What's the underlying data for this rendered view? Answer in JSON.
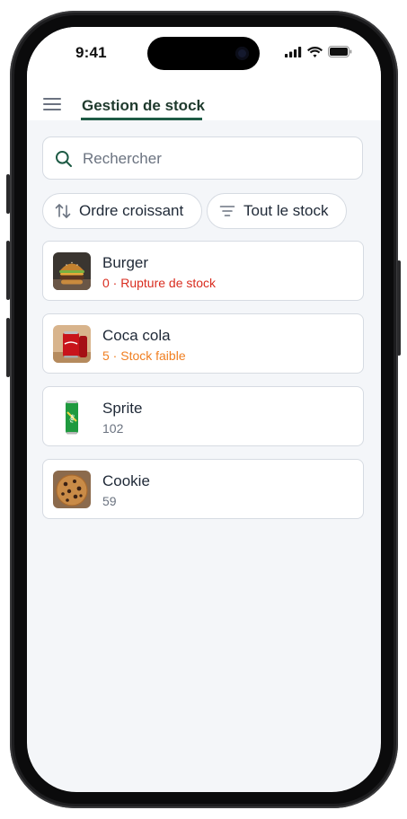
{
  "status_bar": {
    "time": "9:41",
    "icons": [
      "cellular-signal-icon",
      "wifi-icon",
      "battery-icon"
    ]
  },
  "header": {
    "menu_icon": "hamburger-menu-icon",
    "title": "Gestion de stock"
  },
  "search": {
    "placeholder": "Rechercher",
    "value": ""
  },
  "filters": {
    "sort_label": "Ordre croissant",
    "sort_icon": "sort-arrows-icon",
    "stock_label": "Tout le stock",
    "stock_icon": "filter-icon"
  },
  "products": [
    {
      "name": "Burger",
      "stock": "0 · Rupture de stock",
      "status": "out"
    },
    {
      "name": "Coca cola",
      "stock": "5 · Stock faible",
      "status": "low"
    },
    {
      "name": "Sprite",
      "stock": "102",
      "status": "ok"
    },
    {
      "name": "Cookie",
      "stock": "59",
      "status": "ok"
    }
  ],
  "colors": {
    "accent": "#1d5a44",
    "out_of_stock": "#d92d20",
    "low_stock": "#f07f21",
    "muted": "#6b7380",
    "background": "#f4f6f9"
  }
}
